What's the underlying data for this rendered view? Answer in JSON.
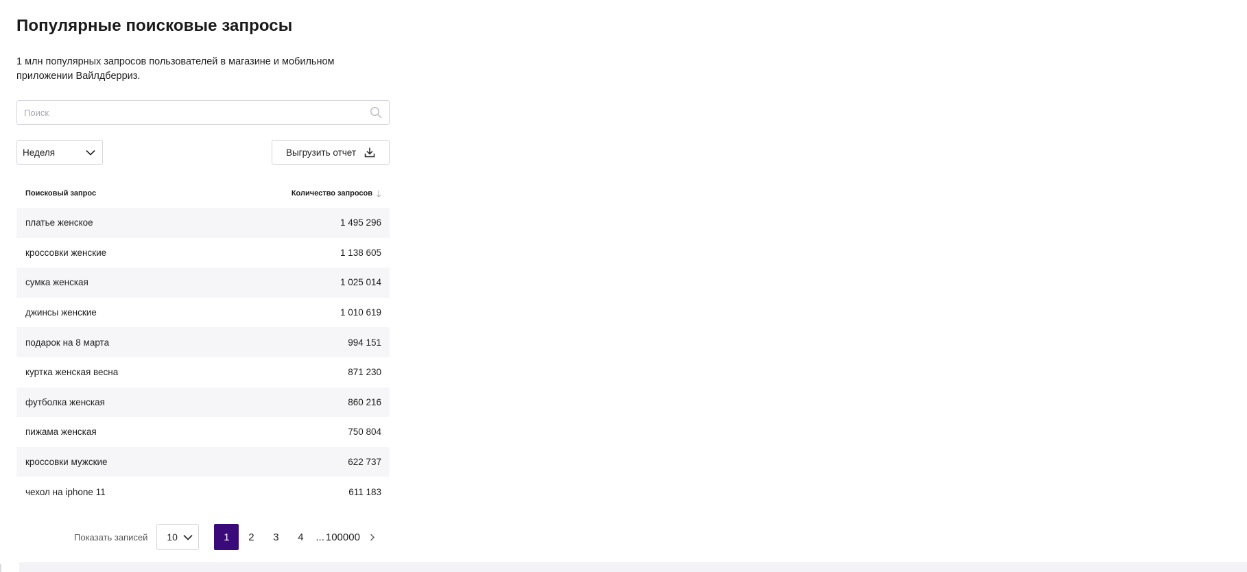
{
  "page": {
    "title": "Популярные поисковые запросы",
    "description": "1 млн популярных запросов пользователей в магазине и мобильном приложении Вайлдберриз."
  },
  "search": {
    "placeholder": "Поиск",
    "value": "",
    "icon": "search-icon"
  },
  "period_select": {
    "value": "Неделя",
    "icon": "chevron-down-icon"
  },
  "export_button": {
    "label": "Выгрузить отчет",
    "icon": "download-icon"
  },
  "table": {
    "columns": {
      "query": "Поисковый запрос",
      "count": "Количество запросов",
      "sort_icon": "arrow-down-icon"
    },
    "rows": [
      {
        "query": "платье женское",
        "count": "1 495 296"
      },
      {
        "query": "кроссовки женские",
        "count": "1 138 605"
      },
      {
        "query": "сумка женская",
        "count": "1 025 014"
      },
      {
        "query": "джинсы женские",
        "count": "1 010 619"
      },
      {
        "query": "подарок на 8 марта",
        "count": "994 151"
      },
      {
        "query": "куртка женская весна",
        "count": "871 230"
      },
      {
        "query": "футболка женская",
        "count": "860 216"
      },
      {
        "query": "пижама женская",
        "count": "750 804"
      },
      {
        "query": "кроссовки мужские",
        "count": "622 737"
      },
      {
        "query": "чехол на iphone 11",
        "count": "611 183"
      }
    ]
  },
  "pagination": {
    "per_page_label": "Показать записей",
    "per_page_value": "10",
    "pages": [
      "1",
      "2",
      "3",
      "4"
    ],
    "active_page": "1",
    "ellipsis": "...",
    "last_page": "100000",
    "next_icon": "chevron-right-icon"
  },
  "colors": {
    "accent": "#3b0a7a",
    "row_stripe": "#f6f6f9",
    "border": "#d6d6dc"
  }
}
